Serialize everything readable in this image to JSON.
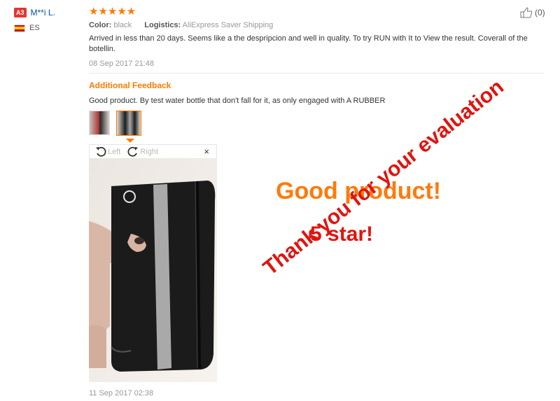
{
  "user": {
    "badge": "A3",
    "name": "M**i L.",
    "country": "ES"
  },
  "review": {
    "stars_text": "★★★★★",
    "rating": 5,
    "color_label": "Color:",
    "color_value": "black",
    "logistics_label": "Logistics:",
    "logistics_value": "AliExpress Saver Shipping",
    "body": "Arrived in less than 20 days. Seems like a the despripcion and well in quality. To try RUN with It to View the result. Coverall of the botellin.",
    "date": "08 Sep 2017 21:48",
    "helpful_count": "(0)"
  },
  "additional_feedback": {
    "title": "Additional Feedback",
    "text": "Good product. By test water bottle that don't fall for it, as only engaged with A RUBBER",
    "viewer": {
      "left_label": "Left",
      "right_label": "Right",
      "close_label": "×"
    },
    "date": "11 Sep 2017 02:38"
  },
  "promo": {
    "line1": "Good product!",
    "line2": "5 star!",
    "line3": "Thank you for your evaluation"
  },
  "colors": {
    "accent": "#ff7a00",
    "red": "#e0140f",
    "link": "#0051a5"
  },
  "icons": [
    "thumbs-up-icon",
    "rotate-left-icon",
    "rotate-right-icon",
    "close-icon",
    "spain-flag-icon"
  ]
}
